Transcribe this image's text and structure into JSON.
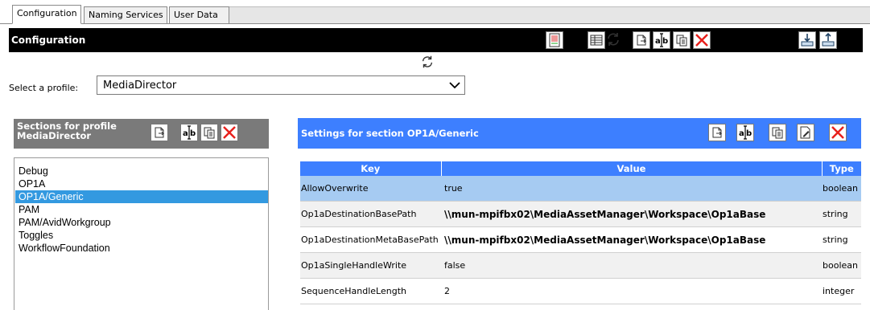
{
  "tabs": [
    {
      "label": "Configuration",
      "active": true
    },
    {
      "label": "Naming Services",
      "active": false
    },
    {
      "label": "User Data",
      "active": false
    }
  ],
  "header": {
    "title": "Configuration",
    "toolbar_icons": [
      "report-icon",
      "table-icon",
      "refresh-config-icon",
      "new-icon",
      "rename-icon",
      "copy-icon",
      "delete-icon",
      "import-icon",
      "export-icon"
    ]
  },
  "profile": {
    "label": "Select a profile:",
    "selected": "MediaDirector"
  },
  "sections": {
    "title": "Sections for profile MediaDirector",
    "items": [
      "Debug",
      "OP1A",
      "OP1A/Generic",
      "PAM",
      "PAM/AvidWorkgroup",
      "Toggles",
      "WorkflowFoundation"
    ],
    "selected_index": 2
  },
  "settings": {
    "title": "Settings for section OP1A/Generic",
    "columns": [
      "Key",
      "Value",
      "Type"
    ],
    "rows": [
      {
        "key": "AllowOverwrite",
        "value": "true",
        "type": "boolean"
      },
      {
        "key": "Op1aDestinationBasePath",
        "value": "\\\\mun-mpifbx02\\MediaAssetManager\\Workspace\\Op1aBase",
        "type": "string"
      },
      {
        "key": "Op1aDestinationMetaBasePath",
        "value": "\\\\mun-mpifbx02\\MediaAssetManager\\Workspace\\Op1aBase",
        "type": "string"
      },
      {
        "key": "Op1aSingleHandleWrite",
        "value": "false",
        "type": "boolean"
      },
      {
        "key": "SequenceHandleLength",
        "value": "2",
        "type": "integer"
      }
    ],
    "selected_row": 0
  },
  "colors": {
    "header_bg": "#000000",
    "settings_header": "#3d7fff",
    "selection": "#3399e0",
    "selected_row": "#a6cbf2",
    "delete_red": "#e8201c"
  }
}
